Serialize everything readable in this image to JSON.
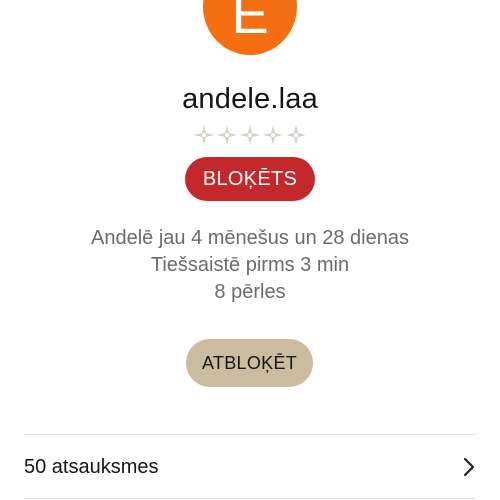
{
  "profile": {
    "avatar_letter": "E",
    "avatar_color": "#f36f12",
    "username": "andele.laa",
    "rating": {
      "filled": 0,
      "max": 5,
      "icon": "diamond-star-icon",
      "empty_color": "#d9d0c1"
    },
    "blocked_badge": "BLOĶĒTS",
    "member_since": "Andelē jau 4 mēnešus un 28 dienas",
    "last_online": "Tiešsaistē pirms 3 min",
    "pearls": "8 pērles"
  },
  "actions": {
    "unblock_label": "ATBLOĶĒT"
  },
  "reviews": {
    "label": "50 atsauksmes",
    "icon": "chevron-right-icon"
  },
  "colors": {
    "blocked_red": "#c4282b",
    "unblock_beige": "#cbbb9f"
  }
}
